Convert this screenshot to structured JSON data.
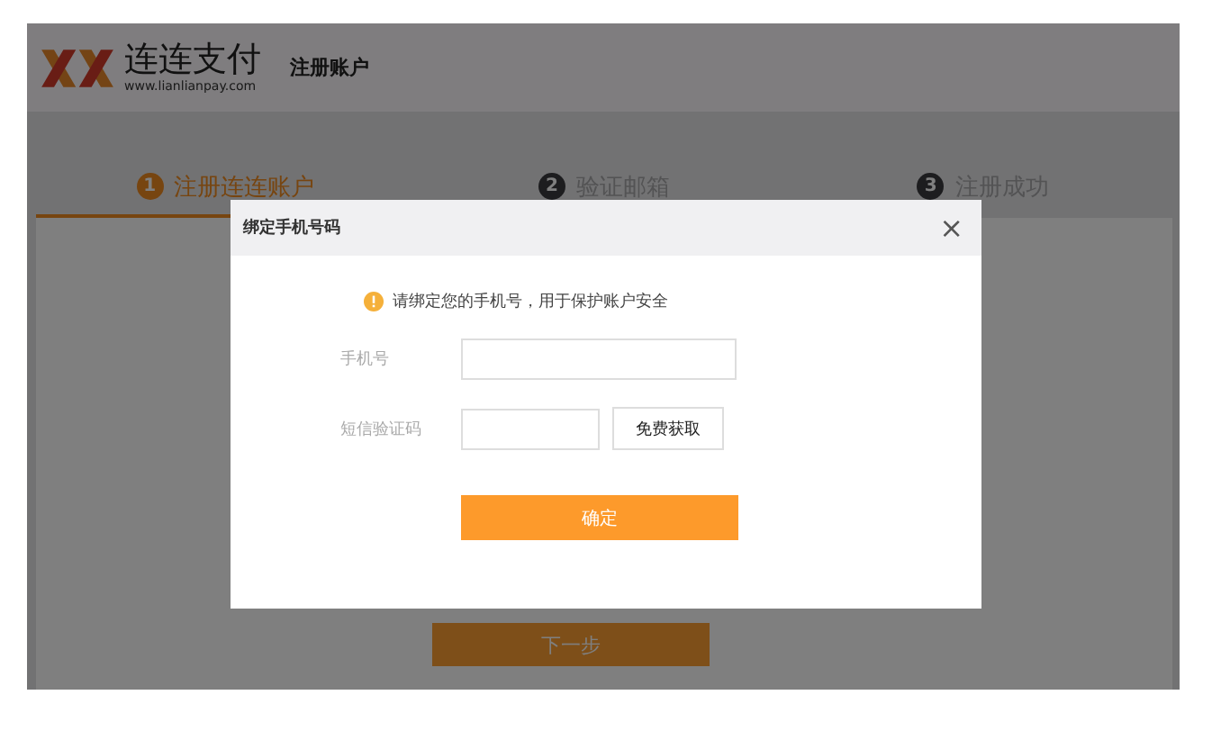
{
  "header": {
    "brand": "连连支付",
    "url": "www.lianlianpay.com",
    "title": "注册账户"
  },
  "steps": [
    {
      "number": "1",
      "label": "注册连连账户",
      "selected": true
    },
    {
      "number": "2",
      "label": "验证邮箱",
      "selected": false
    },
    {
      "number": "3",
      "label": "注册成功",
      "selected": false
    }
  ],
  "next_button": "下一步",
  "dialog": {
    "title": "绑定手机号码",
    "close": "×",
    "notice": "请绑定您的手机号，用于保护账户安全",
    "fields": [
      {
        "kind": "text",
        "label": "手机号"
      },
      {
        "kind": "code",
        "label": "短信验证码",
        "button": "免费获取"
      }
    ],
    "confirm": "确定"
  }
}
